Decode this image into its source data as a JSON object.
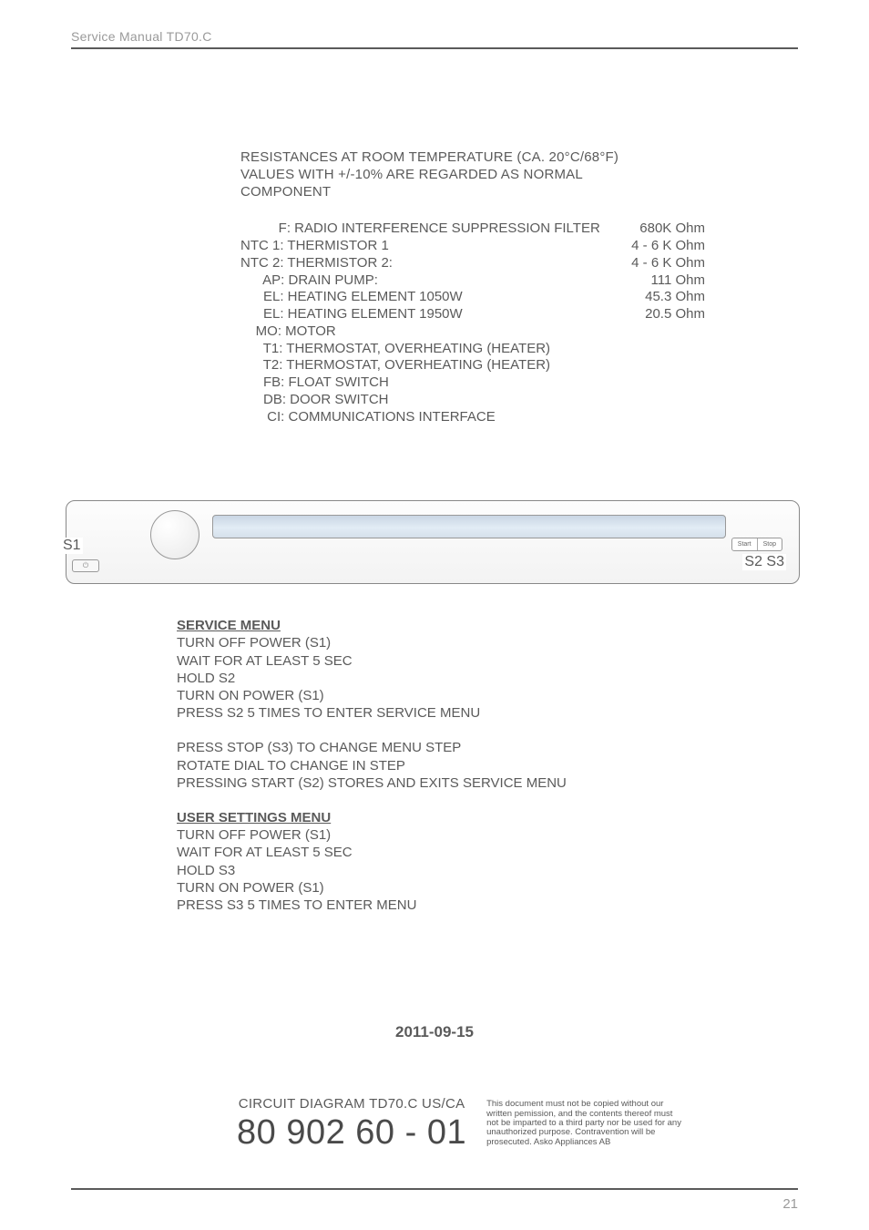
{
  "header": {
    "title": "Service Manual TD70.C"
  },
  "resistance": {
    "line1": "RESISTANCES AT ROOM TEMPERATURE (CA. 20°C/68°F)",
    "line2": "VALUES WITH +/-10% ARE REGARDED AS NORMAL",
    "line3": "COMPONENT"
  },
  "components": [
    {
      "label": "          F: RADIO INTERFERENCE SUPPRESSION FILTER",
      "value": "680K Ohm"
    },
    {
      "label": "NTC 1: THERMISTOR 1",
      "value": "4 - 6 K Ohm"
    },
    {
      "label": "NTC 2: THERMISTOR 2:",
      "value": "4 - 6 K Ohm"
    },
    {
      "label": "      AP: DRAIN PUMP:",
      "value": "111 Ohm"
    },
    {
      "label": "      EL: HEATING ELEMENT 1050W",
      "value": "45.3 Ohm"
    },
    {
      "label": "      EL: HEATING ELEMENT 1950W",
      "value": "20.5 Ohm"
    },
    {
      "label": "    MO: MOTOR",
      "value": ""
    },
    {
      "label": "      T1: THERMOSTAT, OVERHEATING (HEATER)",
      "value": ""
    },
    {
      "label": "      T2: THERMOSTAT, OVERHEATING (HEATER)",
      "value": ""
    },
    {
      "label": "      FB: FLOAT SWITCH",
      "value": ""
    },
    {
      "label": "      DB: DOOR SWITCH",
      "value": ""
    },
    {
      "label": "       CI: COMMUNICATIONS INTERFACE",
      "value": ""
    }
  ],
  "panel": {
    "s1": "S1",
    "s2s3": "S2 S3",
    "power_icon": "⏻",
    "start": "Start",
    "stop": "Stop"
  },
  "service_menu": {
    "heading": "SERVICE MENU",
    "lines_a": [
      "TURN OFF POWER (S1)",
      "WAIT FOR AT LEAST 5 SEC",
      "HOLD S2",
      "TURN ON POWER (S1)",
      "PRESS S2 5 TIMES TO ENTER SERVICE MENU"
    ],
    "lines_b": [
      "PRESS STOP (S3) TO CHANGE MENU STEP",
      "ROTATE DIAL TO CHANGE IN STEP",
      "PRESSING START (S2) STORES AND EXITS SERVICE MENU"
    ]
  },
  "user_menu": {
    "heading": "USER SETTINGS MENU",
    "lines": [
      "TURN OFF POWER (S1)",
      "WAIT FOR AT LEAST 5 SEC",
      "HOLD S3",
      "TURN ON POWER (S1)",
      "PRESS S3 5 TIMES TO ENTER MENU"
    ]
  },
  "date": "2011-09-15",
  "footer": {
    "diagram_label": "CIRCUIT DIAGRAM TD70.C US/CA",
    "part_number": "80 902 60 - 01",
    "legal": "This document must not be copied without our written pemission, and the contents thereof must not be imparted to a third party nor be used for any unauthorized purpose. Contravention will be prosecuted. Asko Appliances AB"
  },
  "page": "21"
}
